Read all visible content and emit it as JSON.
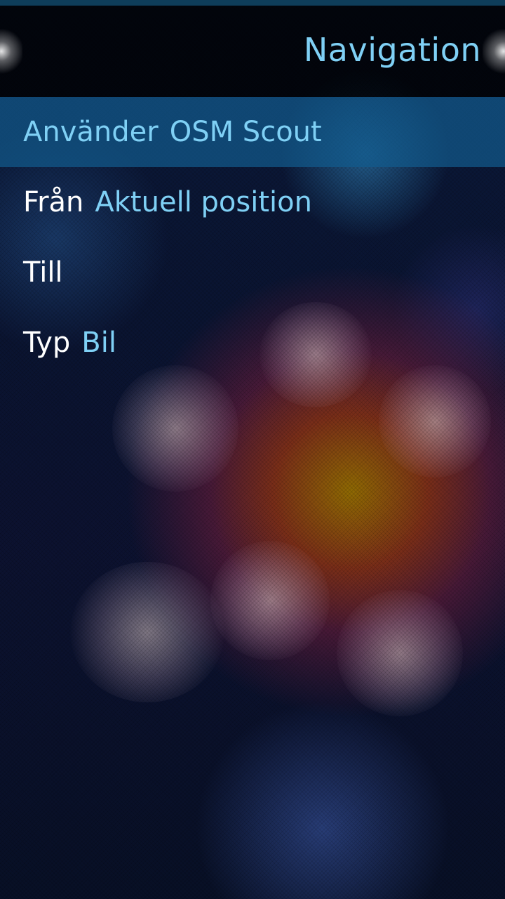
{
  "page": {
    "title": "Navigation"
  },
  "items": [
    {
      "label": "Använder",
      "value": "OSM Scout"
    },
    {
      "label": "Från",
      "value": "Aktuell position"
    },
    {
      "label": "Till",
      "value": ""
    },
    {
      "label": "Typ",
      "value": "Bil"
    }
  ],
  "colors": {
    "accent": "#7fd0f5",
    "highlight": "#125a8c",
    "text": "#ffffff"
  }
}
